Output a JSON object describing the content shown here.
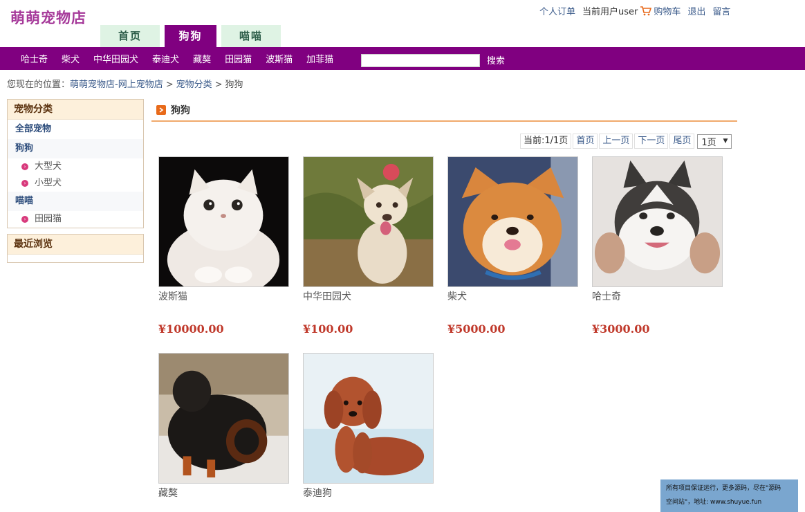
{
  "logo": "萌萌宠物店",
  "top_links": {
    "orders": "个人订单",
    "current_user": "当前用户user",
    "cart": "购物车",
    "logout": "退出",
    "message": "留言"
  },
  "main_tabs": [
    "首页",
    "狗狗",
    "喵喵"
  ],
  "nav_items": [
    "哈士奇",
    "柴犬",
    "中华田园犬",
    "泰迪犬",
    "藏獒",
    "田园猫",
    "波斯猫",
    "加菲猫"
  ],
  "search": {
    "button": "搜索",
    "value": ""
  },
  "breadcrumb": {
    "prefix": "您现在的位置：",
    "items": [
      "萌萌宠物店-网上宠物店",
      "宠物分类",
      "狗狗"
    ],
    "separator": ">"
  },
  "sidebar": {
    "category_title": "宠物分类",
    "all": "全部宠物",
    "dogs": "狗狗",
    "dog_subs": [
      "大型犬",
      "小型犬"
    ],
    "cats": "喵喵",
    "cat_subs": [
      "田园猫"
    ],
    "recent_title": "最近浏览"
  },
  "section_title": "狗狗",
  "pager": {
    "current": "当前:1/1页",
    "first": "首页",
    "prev": "上一页",
    "next": "下一页",
    "last": "尾页",
    "select_value": "1页"
  },
  "products": [
    {
      "name": "波斯猫",
      "price": "¥10000.00"
    },
    {
      "name": "中华田园犬",
      "price": "¥100.00"
    },
    {
      "name": "柴犬",
      "price": "¥5000.00"
    },
    {
      "name": "哈士奇",
      "price": "¥3000.00"
    },
    {
      "name": "藏獒",
      "price": ""
    },
    {
      "name": "泰迪狗",
      "price": ""
    }
  ],
  "notice": {
    "line1": "所有项目保证运行，更多源码，尽在\"源码",
    "line2": "空间站\"，地址: www.shuyue.fun"
  },
  "colors": {
    "brand_purple": "#800080",
    "price_red": "#c0392b",
    "logo": "#a63a9a",
    "tab_green": "#dff3e4"
  }
}
